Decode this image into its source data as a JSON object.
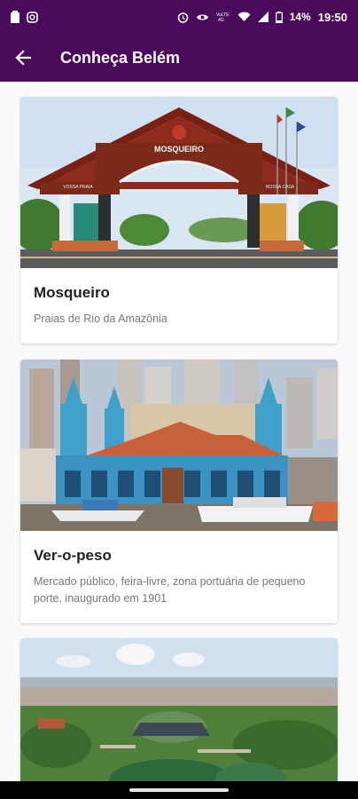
{
  "status_bar": {
    "time": "19:50",
    "battery_percent": "14%",
    "left_icons": [
      "battery-saver-icon",
      "instagram-icon"
    ],
    "right_icons": [
      "alarm-icon",
      "eye-icon",
      "volte-icon",
      "wifi-icon",
      "signal-icon",
      "battery-icon"
    ]
  },
  "app_bar": {
    "title": "Conheça Belém",
    "back_icon": "arrow-back-icon"
  },
  "colors": {
    "primary": "#4a0a5c",
    "card_title": "#222222",
    "card_subtitle": "#777777"
  },
  "cards": [
    {
      "title": "Mosqueiro",
      "subtitle": "Praias de Rio da Amazônia",
      "image_sign": "MOSQUEIRO",
      "image_sign_left": "VOSSA PRAIA",
      "image_sign_right": "NOSSA CASA"
    },
    {
      "title": "Ver-o-peso",
      "subtitle": "Mercado público, feira-livre, zona portuária de pequeno porte, inaugurado em 1901"
    },
    {
      "title": "",
      "subtitle": ""
    }
  ]
}
